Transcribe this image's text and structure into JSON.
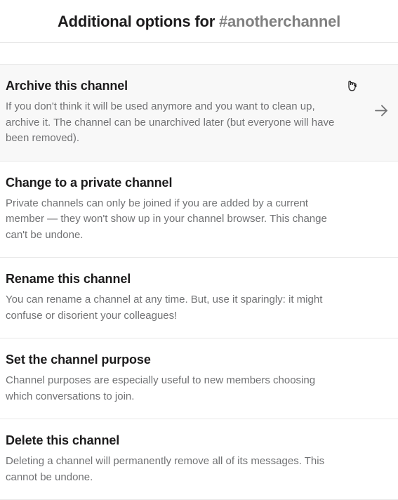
{
  "header": {
    "title_prefix": "Additional options for ",
    "channel_name": "#anotherchannel"
  },
  "options": [
    {
      "title": "Archive this channel",
      "description": "If you don't think it will be used anymore and you want to clean up, archive it. The channel can be unarchived later (but everyone will have been removed).",
      "hovered": true
    },
    {
      "title": "Change to a private channel",
      "description": "Private channels can only be joined if you are added by a current member — they won't show up in your channel browser. This change can't be undone.",
      "hovered": false
    },
    {
      "title": "Rename this channel",
      "description": "You can rename a channel at any time. But, use it sparingly: it might confuse or disorient your colleagues!",
      "hovered": false
    },
    {
      "title": "Set the channel purpose",
      "description": "Channel purposes are especially useful to new members choosing which conversations to join.",
      "hovered": false
    },
    {
      "title": "Delete this channel",
      "description": "Deleting a channel will permanently remove all of its messages. This cannot be undone.",
      "hovered": false
    }
  ]
}
